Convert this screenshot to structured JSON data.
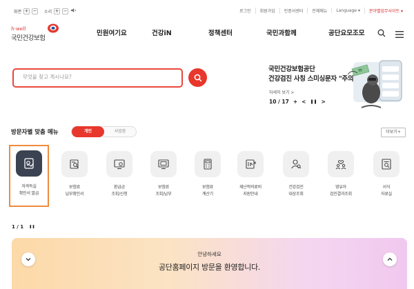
{
  "util": {
    "zoom_in_label": "화면",
    "zoom_plus": "+",
    "zoom_minus": "−",
    "sound_label": "소리",
    "links": [
      "로그인",
      "회원가입",
      "인증서센터",
      "전체메뉴",
      "Language ▾",
      "분야별업무사이트 ▾"
    ]
  },
  "logo": {
    "hwell": "h-well",
    "name": "국민건강보험"
  },
  "gnb": [
    "민원여기요",
    "건강iN",
    "정책센터",
    "국민과함께",
    "공단요모조모"
  ],
  "search": {
    "placeholder": "무엇을 찾고 계시나요?"
  },
  "banner": {
    "title_line1": "국민건강보험공단",
    "title_line2": "건강검진 사칭 스미싱문자 \"주의\"",
    "more": "자세히 보기 >",
    "pager": "10 / 17",
    "plus": "+",
    "prev": "<",
    "pause": "❚❚",
    "next": ">"
  },
  "visitor": {
    "title": "방문자별 맞춤 메뉴",
    "tab_personal": "개인",
    "tab_business": "사업장",
    "more": "더보기+"
  },
  "services": [
    {
      "line1": "자격득실",
      "line2": "확인서 발급",
      "icon": "certificate-check-icon"
    },
    {
      "line1": "보험료",
      "line2": "납부확인서",
      "icon": "document-search-icon"
    },
    {
      "line1": "환급금",
      "line2": "조회/신청",
      "icon": "monitor-refund-icon"
    },
    {
      "line1": "보험료",
      "line2": "조회/납부",
      "icon": "calculator-screen-icon"
    },
    {
      "line1": "보험료",
      "line2": "계산기",
      "icon": "calculator-icon"
    },
    {
      "line1": "재난적의료비",
      "line2": "지원안내",
      "icon": "medical-support-icon"
    },
    {
      "line1": "건강검진",
      "line2": "대상조회",
      "icon": "person-search-icon"
    },
    {
      "line1": "영유아",
      "line2": "검진결과조회",
      "icon": "family-heart-icon"
    },
    {
      "line1": "서식",
      "line2": "자료실",
      "icon": "form-document-icon"
    }
  ],
  "pager2": {
    "text": "1 / 1",
    "pause": "❚❚"
  },
  "welcome": {
    "line1": "안녕하세요",
    "line2": "공단홈페이지 방문을 환영합니다."
  },
  "colors": {
    "accent": "#e8372c",
    "selected_border": "#f08a3c",
    "selected_icon_bg": "#3b4252"
  }
}
